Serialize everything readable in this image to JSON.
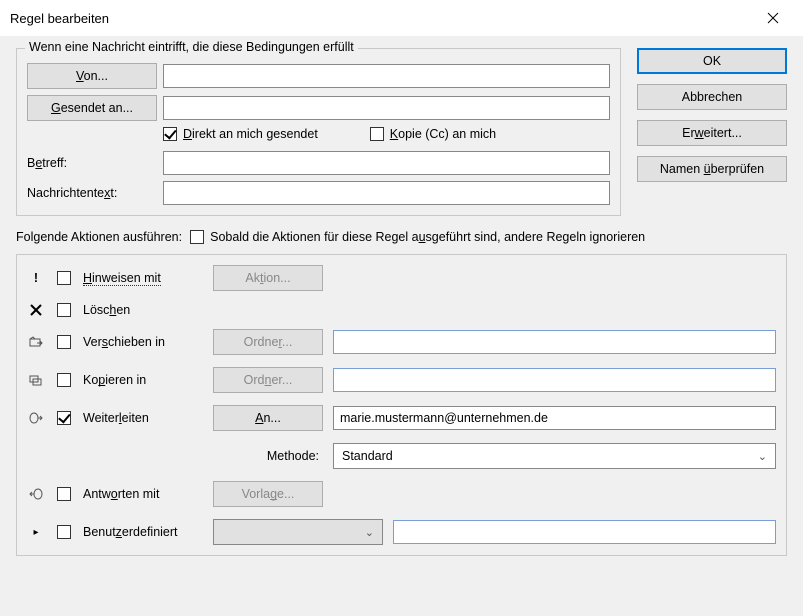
{
  "window": {
    "title": "Regel bearbeiten"
  },
  "buttons": {
    "ok": "OK",
    "cancel": "Abbrechen",
    "advanced": "Erweitert...",
    "check_names": "Namen überprüfen"
  },
  "conditions": {
    "legend": "Wenn eine Nachricht eintrifft, die diese Bedingungen erfüllt",
    "from_btn": "Von...",
    "sent_to_btn": "Gesendet an...",
    "direct_to_me": "Direkt an mich gesendet",
    "cc_to_me": "Kopie (Cc) an mich",
    "subject_label": "Betreff:",
    "body_label": "Nachrichtentext:",
    "from_value": "",
    "sent_to_value": "",
    "subject_value": "",
    "body_value": ""
  },
  "actions_header": {
    "perform_label": "Folgende Aktionen ausführen:",
    "stop_rules": "Sobald die Aktionen für diese Regel ausgeführt sind, andere Regeln ignorieren"
  },
  "actions": {
    "alert": {
      "label": "Hinweisen mit",
      "btn": "Aktion..."
    },
    "delete": {
      "label": "Löschen"
    },
    "move": {
      "label": "Verschieben in",
      "btn": "Ordner...",
      "value": ""
    },
    "copy": {
      "label": "Kopieren in",
      "btn": "Ordner...",
      "value": ""
    },
    "forward": {
      "label": "Weiterleiten",
      "btn": "An...",
      "value": "marie.mustermann@unternehmen.de"
    },
    "method_label": "Methode:",
    "method_value": "Standard",
    "reply": {
      "label": "Antworten mit",
      "btn": "Vorlage..."
    },
    "custom": {
      "label": "Benutzerdefiniert",
      "value": ""
    }
  }
}
